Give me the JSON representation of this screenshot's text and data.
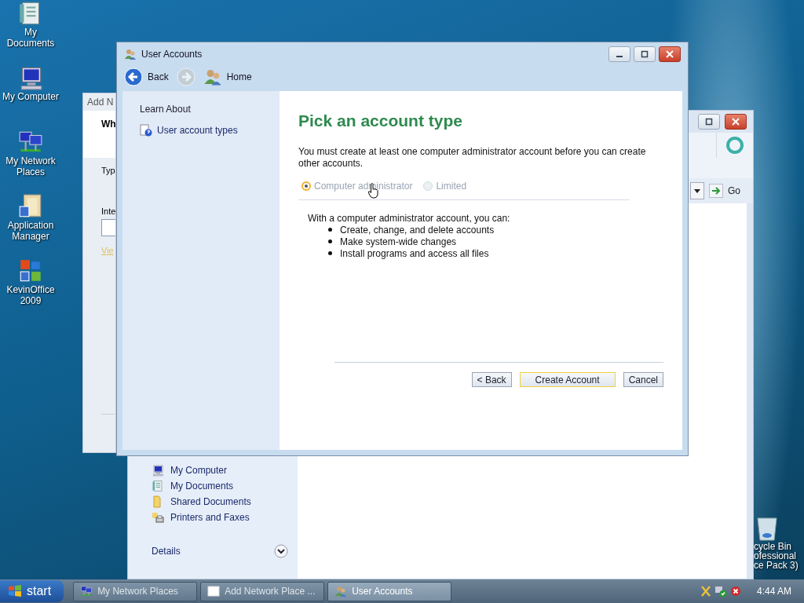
{
  "desktop_icons": [
    {
      "kind": "documents",
      "label": "My Documents"
    },
    {
      "kind": "computer",
      "label": "My Computer"
    },
    {
      "kind": "network",
      "label": "My Network Places"
    },
    {
      "kind": "app-manager",
      "label": "Application Manager"
    },
    {
      "kind": "office",
      "label": "KevinOffice 2009"
    }
  ],
  "recycle_bin": {
    "lines": [
      "cycle Bin",
      "ofessional",
      "ce Pack 3)"
    ]
  },
  "explorer_window": {
    "go_button": "Go",
    "sidebar_items": [
      {
        "kind": "computer",
        "label": "My Computer"
      },
      {
        "kind": "documents",
        "label": "My Documents"
      },
      {
        "kind": "folder",
        "label": "Shared Documents"
      },
      {
        "kind": "printer",
        "label": "Printers and Faxes"
      }
    ],
    "details": {
      "label": "Details",
      "expanded": false
    }
  },
  "add_network_window": {
    "title": "Add N",
    "heading": "Wh",
    "label_1": "Typ",
    "label_2": "Inte",
    "link": "Vie"
  },
  "user_accounts_window": {
    "title": "User Accounts",
    "toolbar": [
      {
        "kind": "back",
        "label": "Back",
        "disabled": false
      },
      {
        "kind": "forward",
        "disabled": true
      },
      {
        "kind": "home",
        "label": "Home",
        "disabled": false
      }
    ],
    "sidebar": {
      "heading": "Learn About",
      "links": [
        "User account types"
      ]
    },
    "heading": "Pick an account type",
    "intro": "You must create at least one computer administrator account before you can create other accounts.",
    "options": [
      {
        "label": "Computer administrator",
        "selected": true
      },
      {
        "label": "Limited",
        "selected": false
      }
    ],
    "description": "With a computer administrator account, you can:",
    "bullets": [
      "Create, change, and delete accounts",
      "Make system-wide changes",
      "Install programs and access all files"
    ],
    "buttons": [
      {
        "label": "< Back",
        "focused": false
      },
      {
        "label": "Create Account",
        "focused": true
      },
      {
        "label": "Cancel",
        "focused": false
      }
    ]
  },
  "taskbar": {
    "start": "start",
    "tasks": [
      {
        "kind": "network",
        "label": "My Network Places",
        "selected": false
      },
      {
        "kind": "window",
        "label": "Add Network Place ...",
        "selected": false
      },
      {
        "kind": "users",
        "label": "User Accounts",
        "selected": true
      }
    ],
    "clock": "4:44 AM"
  }
}
